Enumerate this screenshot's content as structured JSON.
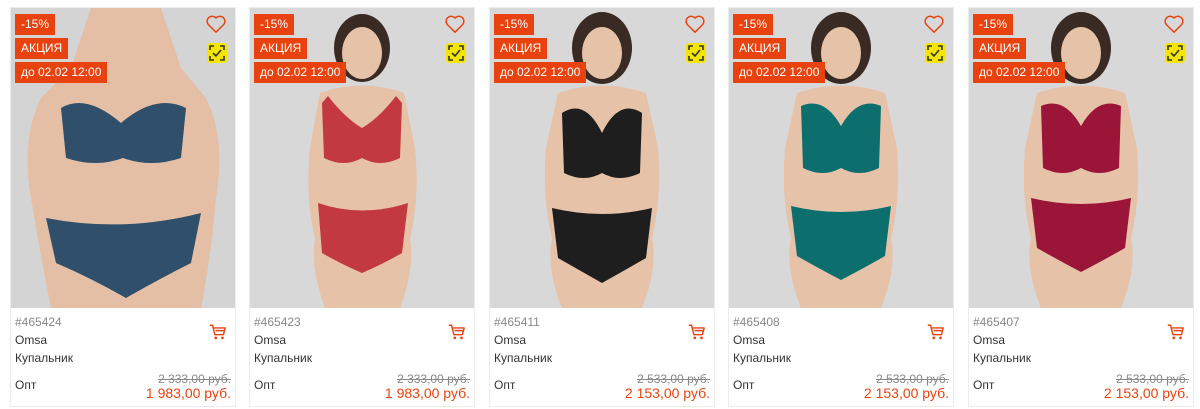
{
  "colors": {
    "accent": "#e8430f",
    "scan_bg": "#f4e600"
  },
  "products": [
    {
      "discount": "-15%",
      "promo": "АКЦИЯ",
      "deadline": "до 02.02 12:00",
      "sku": "#465424",
      "brand": "Omsa",
      "name": "Купальник",
      "price_label": "Опт",
      "old_price": "2 333,00 руб.",
      "price": "1 983,00 руб.",
      "swimsuit_color": "#2f4f6b"
    },
    {
      "discount": "-15%",
      "promo": "АКЦИЯ",
      "deadline": "до 02.02 12:00",
      "sku": "#465423",
      "brand": "Omsa",
      "name": "Купальник",
      "price_label": "Опт",
      "old_price": "2 333,00 руб.",
      "price": "1 983,00 руб.",
      "swimsuit_color": "#c23a3f"
    },
    {
      "discount": "-15%",
      "promo": "АКЦИЯ",
      "deadline": "до 02.02 12:00",
      "sku": "#465411",
      "brand": "Omsa",
      "name": "Купальник",
      "price_label": "Опт",
      "old_price": "2 533,00 руб.",
      "price": "2 153,00 руб.",
      "swimsuit_color": "#1e1e1e"
    },
    {
      "discount": "-15%",
      "promo": "АКЦИЯ",
      "deadline": "до 02.02 12:00",
      "sku": "#465408",
      "brand": "Omsa",
      "name": "Купальник",
      "price_label": "Опт",
      "old_price": "2 533,00 руб.",
      "price": "2 153,00 руб.",
      "swimsuit_color": "#0d6e6e"
    },
    {
      "discount": "-15%",
      "promo": "АКЦИЯ",
      "deadline": "до 02.02 12:00",
      "sku": "#465407",
      "brand": "Omsa",
      "name": "Купальник",
      "price_label": "Опт",
      "old_price": "2 533,00 руб.",
      "price": "2 153,00 руб.",
      "swimsuit_color": "#9a1538"
    }
  ]
}
